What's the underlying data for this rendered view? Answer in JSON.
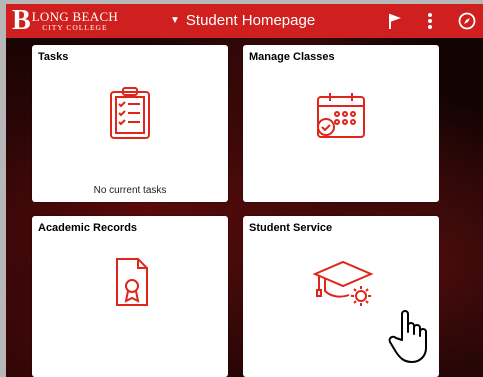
{
  "header": {
    "logo_mark": "B",
    "logo_line1": "LONG BEACH",
    "logo_line2": "CITY COLLEGE",
    "title": "Student Homepage",
    "icons": [
      "flag-icon",
      "more-vert-icon",
      "compass-icon"
    ]
  },
  "tiles": [
    {
      "title": "Tasks",
      "footer": "No current tasks",
      "icon": "clipboard-checklist-icon"
    },
    {
      "title": "Manage Classes",
      "footer": "",
      "icon": "calendar-check-icon"
    },
    {
      "title": "Academic Records",
      "footer": "",
      "icon": "certificate-document-icon"
    },
    {
      "title": "Student Service",
      "footer": "",
      "icon": "graduation-cap-gear-icon"
    }
  ],
  "colors": {
    "brand_red": "#cf1f1f",
    "icon_red": "#e0251b",
    "background": "#2a0606"
  }
}
